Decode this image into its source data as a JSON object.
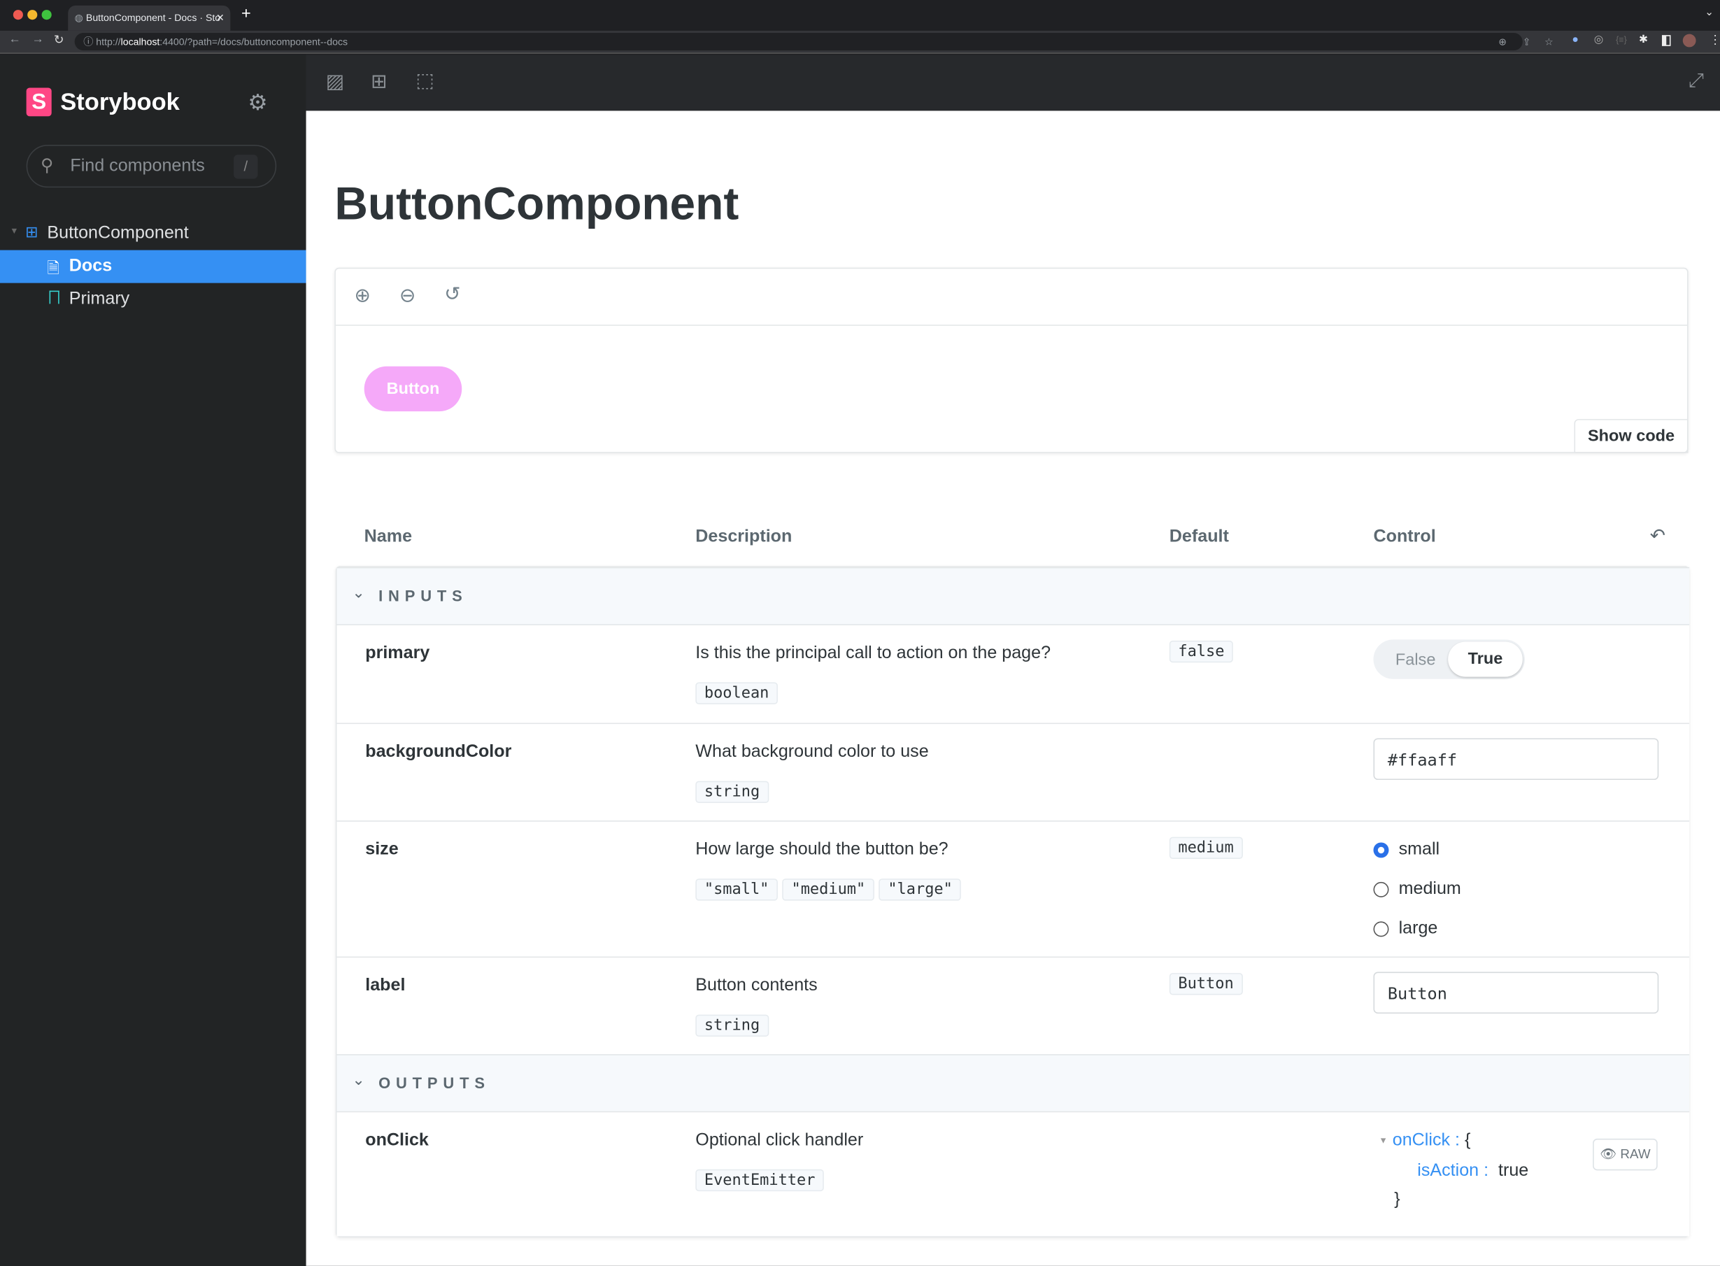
{
  "browser": {
    "tab_title": "ButtonComponent - Docs · Sto",
    "url_prefix": "http://",
    "url_host": "localhost",
    "url_rest": ":4400/?path=/docs/buttoncomponent--docs"
  },
  "sidebar": {
    "brand": "Storybook",
    "search_placeholder": "Find components",
    "search_shortcut": "/",
    "tree": [
      {
        "label": "ButtonComponent",
        "icon": "component-icon"
      },
      {
        "label": "Docs",
        "icon": "document-icon",
        "selected": true
      },
      {
        "label": "Primary",
        "icon": "bookmark-icon"
      }
    ]
  },
  "colors": {
    "accent": "#3590f3",
    "preview_button": "#f5a9f9"
  },
  "main": {
    "title": "ButtonComponent",
    "preview": {
      "button_label": "Button",
      "show_code": "Show code"
    },
    "table": {
      "headers": [
        "Name",
        "Description",
        "Default",
        "Control"
      ],
      "sections": [
        {
          "title": "INPUTS"
        },
        {
          "title": "OUTPUTS"
        }
      ],
      "rows": [
        {
          "name": "primary",
          "description": "Is this the principal call to action on the page?",
          "type": "boolean",
          "default": "false",
          "control": {
            "options": [
              "False",
              "True"
            ],
            "selected": "True"
          }
        },
        {
          "name": "backgroundColor",
          "description": "What background color to use",
          "type": "string",
          "control": {
            "value": "#ffaaff"
          }
        },
        {
          "name": "size",
          "description": "How large should the button be?",
          "types": [
            "\"small\"",
            "\"medium\"",
            "\"large\""
          ],
          "default": "medium",
          "control": {
            "options": [
              "small",
              "medium",
              "large"
            ],
            "selected": "small"
          }
        },
        {
          "name": "label",
          "description": "Button contents",
          "type": "string",
          "default": "Button",
          "control": {
            "value": "Button"
          }
        },
        {
          "name": "onClick",
          "description": "Optional click handler",
          "type": "EventEmitter",
          "control": {
            "key": "onClick",
            "open": "{",
            "child_key": "isAction",
            "child_value": "true",
            "close": "}",
            "raw_label": "RAW"
          }
        }
      ]
    }
  }
}
